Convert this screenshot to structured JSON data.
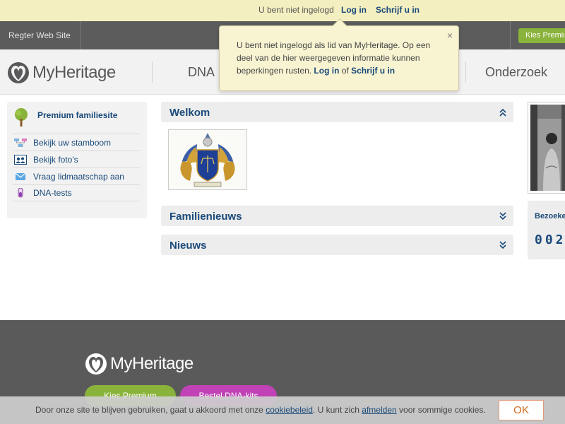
{
  "notice_bar": {
    "text": "U bent niet ingelogd",
    "login": "Log in",
    "signup": "Schrijf u in"
  },
  "site_bar": {
    "register": "Regter Web Site",
    "premium": "Kies Premium"
  },
  "header": {
    "logo": "MyHeritage",
    "nav_dna": "DNA",
    "nav_research": "Onderzoek"
  },
  "popup": {
    "text_before": "U bent niet ingelogd als lid van MyHeritage. Op een deel van de hier weergegeven informatie kunnen beperkingen rusten.",
    "login": "Log in",
    "or": "of",
    "signup": "Schrijf u in",
    "close": "×"
  },
  "sidebar": {
    "title": "Premium familiesite",
    "items": [
      {
        "label": "Bekijk uw stamboom",
        "icon": "family-tree-icon"
      },
      {
        "label": "Bekijk foto's",
        "icon": "photos-icon"
      },
      {
        "label": "Vraag lidmaatschap aan",
        "icon": "envelope-icon"
      },
      {
        "label": "DNA-tests",
        "icon": "dna-tube-icon"
      }
    ]
  },
  "panels": {
    "welcome": "Welkom",
    "family_news": "Familienieuws",
    "news": "Nieuws"
  },
  "visitors": {
    "label": "Bezoekers",
    "count": "002"
  },
  "footer": {
    "logo": "MyHeritage",
    "premium": "Kies Premium",
    "dna": "Bestel DNA-kits"
  },
  "cookie": {
    "text1": "Door onze site te blijven gebruiken, gaat u akkoord met onze",
    "link1": "cookiebeleid",
    "text2": ". U kunt zich",
    "link2": "afmelden",
    "text3": "voor sommige cookies.",
    "ok": "OK"
  },
  "colors": {
    "brand_blue": "#1a4a7a",
    "premium_green": "#8ab33b",
    "dna_purple": "#c042b6",
    "notice_yellow": "#f4efc0"
  }
}
